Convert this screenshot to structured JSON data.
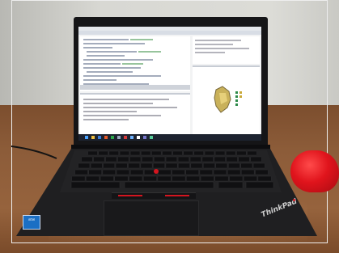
{
  "photo": {
    "subject": "laptop-on-desk",
    "colors": {
      "wall": "#d9d9d4",
      "wall_shadow": "#a9a9a5",
      "desk": "#8a5a38",
      "desk_dark": "#5a3820",
      "laptop_body": "#1c1c1e",
      "keyboard_deck": "#232325",
      "key": "#141416",
      "screen_bg": "#f2f3f4",
      "taskbar": "#1d2330",
      "red_accent": "#d4151f",
      "mouse": "#e0141c"
    }
  },
  "screen": {
    "app": "rstudio-ide",
    "taskbar_icon_count": 14
  },
  "laptop": {
    "brand_logo": "ThinkPad",
    "sticker": "intel"
  }
}
